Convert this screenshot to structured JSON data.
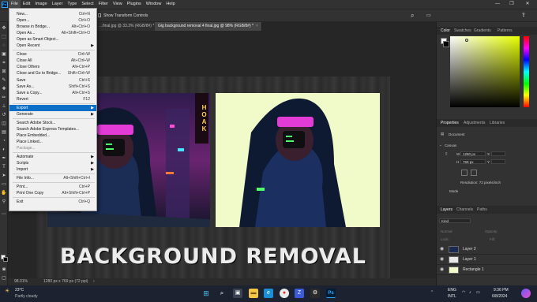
{
  "app": {
    "logo": "Ps",
    "menu": [
      "File",
      "Edit",
      "Image",
      "Layer",
      "Type",
      "Select",
      "Filter",
      "View",
      "Plugins",
      "Window",
      "Help"
    ],
    "window_controls": {
      "minimize": "—",
      "maximize": "❐",
      "close": "✕"
    }
  },
  "options_bar": {
    "show_transform_controls": "Show Transform Controls"
  },
  "tabs": [
    {
      "label": "...final.jpg @ 33.3% (RGB/8#) *",
      "close": "×",
      "active": false
    },
    {
      "label": "Gig background removal 4 final.jpg @ 98% (RGB/8#) *",
      "close": "×",
      "active": true
    }
  ],
  "file_menu": {
    "items": [
      {
        "label": "New...",
        "shortcut": "Ctrl+N",
        "disabled": false
      },
      {
        "label": "Open...",
        "shortcut": "Ctrl+O",
        "disabled": false
      },
      {
        "label": "Browse in Bridge...",
        "shortcut": "Alt+Ctrl+O",
        "disabled": false
      },
      {
        "label": "Open As...",
        "shortcut": "Alt+Shift+Ctrl+O",
        "disabled": false
      },
      {
        "label": "Open as Smart Object...",
        "shortcut": "",
        "disabled": false
      },
      {
        "label": "Open Recent",
        "shortcut": "",
        "submenu": true,
        "disabled": false
      },
      {
        "sep": true
      },
      {
        "label": "Close",
        "shortcut": "Ctrl+W",
        "disabled": false
      },
      {
        "label": "Close All",
        "shortcut": "Alt+Ctrl+W",
        "disabled": false
      },
      {
        "label": "Close Others",
        "shortcut": "Alt+Ctrl+P",
        "disabled": false
      },
      {
        "label": "Close and Go to Bridge...",
        "shortcut": "Shift+Ctrl+W",
        "disabled": false
      },
      {
        "label": "Save",
        "shortcut": "Ctrl+S",
        "disabled": false
      },
      {
        "label": "Save As...",
        "shortcut": "Shift+Ctrl+S",
        "disabled": false
      },
      {
        "label": "Save a Copy...",
        "shortcut": "Alt+Ctrl+S",
        "disabled": false
      },
      {
        "label": "Revert",
        "shortcut": "F12",
        "disabled": false
      },
      {
        "sep": true
      },
      {
        "label": "Export",
        "shortcut": "",
        "submenu": true,
        "highlighted": true,
        "disabled": false
      },
      {
        "label": "Generate",
        "shortcut": "",
        "submenu": true,
        "disabled": false
      },
      {
        "sep": true
      },
      {
        "label": "Search Adobe Stock...",
        "shortcut": "",
        "disabled": false
      },
      {
        "label": "Search Adobe Express Templates...",
        "shortcut": "",
        "disabled": false
      },
      {
        "label": "Place Embedded...",
        "shortcut": "",
        "disabled": false
      },
      {
        "label": "Place Linked...",
        "shortcut": "",
        "disabled": false
      },
      {
        "label": "Package...",
        "shortcut": "",
        "disabled": true
      },
      {
        "sep": true
      },
      {
        "label": "Automate",
        "shortcut": "",
        "submenu": true,
        "disabled": false
      },
      {
        "label": "Scripts",
        "shortcut": "",
        "submenu": true,
        "disabled": false
      },
      {
        "label": "Import",
        "shortcut": "",
        "submenu": true,
        "disabled": false
      },
      {
        "sep": true
      },
      {
        "label": "File Info...",
        "shortcut": "Alt+Shift+Ctrl+I",
        "disabled": false
      },
      {
        "sep": true
      },
      {
        "label": "Print...",
        "shortcut": "Ctrl+P",
        "disabled": false
      },
      {
        "label": "Print One Copy",
        "shortcut": "Alt+Shift+Ctrl+P",
        "disabled": false
      },
      {
        "sep": true
      },
      {
        "label": "Exit",
        "shortcut": "Ctrl+Q",
        "disabled": false
      }
    ]
  },
  "canvas": {
    "headline": "BACKGROUND REMOVAL",
    "neon_sign": "HOAK",
    "right_bg_color": "#f0fbc9"
  },
  "status_bar": {
    "zoom": "98.01%",
    "doc_info": "1280 px x 769 px (72 ppi)"
  },
  "color_panel": {
    "tabs": [
      "Color",
      "Swatches",
      "Gradients",
      "Patterns"
    ]
  },
  "properties_panel": {
    "tabs": [
      "Properties",
      "Adjustments",
      "Libraries"
    ],
    "document_label": "Document",
    "section": "Canvas",
    "w_label": "W",
    "w_value": "1280 px",
    "h_label": "H",
    "h_value": "769 px",
    "x_label": "X",
    "y_label": "Y",
    "resolution": "Resolution: 72 pixels/inch",
    "mode": "Mode"
  },
  "layers_panel": {
    "tabs": [
      "Layers",
      "Channels",
      "Paths"
    ],
    "kind": "Kind",
    "normal": "Normal",
    "opacity": "Opacity:",
    "lock": "Lock:",
    "fill": "Fill:",
    "layers": [
      {
        "name": "Layer 2"
      },
      {
        "name": "Layer 1"
      },
      {
        "name": "Rectangle 1"
      }
    ]
  },
  "taskbar": {
    "weather_temp": "23°C",
    "weather_desc": "Partly cloudy",
    "lang_top": "ENG",
    "lang_bottom": "INTL",
    "time": "9:36 PM",
    "date": "6/8/2024"
  }
}
